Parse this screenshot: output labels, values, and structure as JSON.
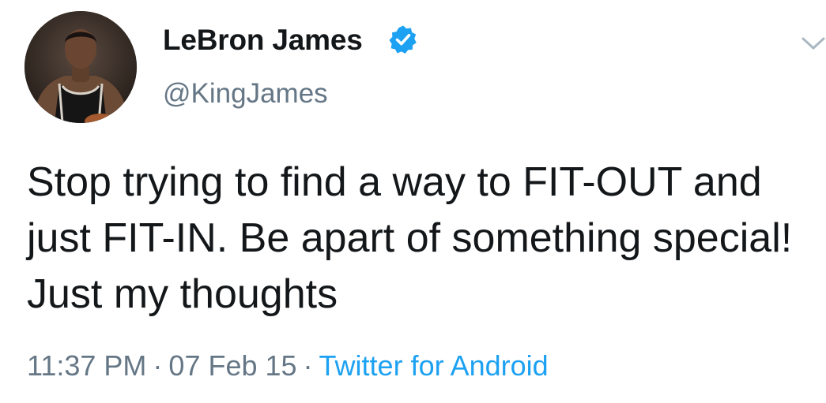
{
  "user": {
    "display_name": "LeBron James",
    "handle": "@KingJames",
    "verified": true,
    "avatar_icon": "profile-photo"
  },
  "tweet": {
    "text": "Stop trying to find a way to FIT-OUT and just FIT-IN. Be apart of something special! Just my thoughts",
    "time": "11:37 PM",
    "separator": "·",
    "date": "07 Feb 15",
    "source": "Twitter for Android"
  },
  "colors": {
    "text": "#14171a",
    "secondary_text": "#657786",
    "link": "#1da1f2",
    "verified_badge": "#1da1f2"
  },
  "icons": {
    "verified": "verified-badge-icon",
    "menu": "chevron-down-icon"
  }
}
